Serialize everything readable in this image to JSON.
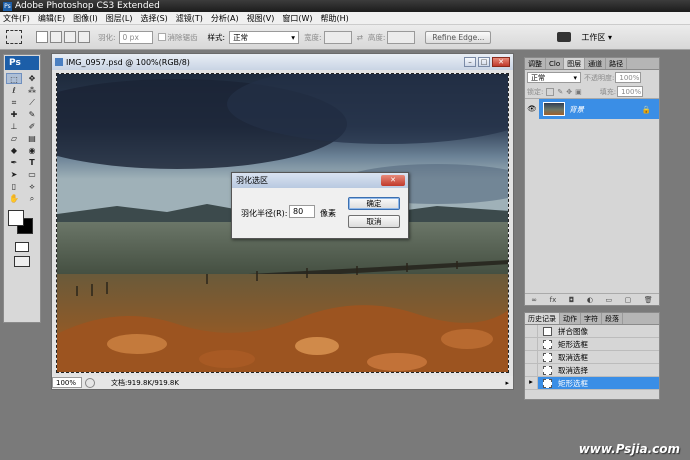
{
  "app": {
    "title": "Adobe Photoshop CS3 Extended",
    "icon_text": "Ps"
  },
  "menu": [
    "文件(F)",
    "编辑(E)",
    "图像(I)",
    "图层(L)",
    "选择(S)",
    "滤镜(T)",
    "分析(A)",
    "视图(V)",
    "窗口(W)",
    "帮助(H)"
  ],
  "options": {
    "feather_label": "羽化:",
    "feather_value": "0 px",
    "antialias_label": "消除锯齿",
    "style_label": "样式:",
    "style_value": "正常",
    "width_label": "宽度:",
    "height_label": "高度:",
    "refine_edge": "Refine Edge...",
    "workspace": "工作区 ▾"
  },
  "toolbox": {
    "logo": "Ps"
  },
  "document": {
    "title": "IMG_0957.psd @ 100%(RGB/8)",
    "zoom": "100%",
    "doc_info": "文档:919.8K/919.8K"
  },
  "dialog": {
    "title": "羽化选区",
    "label": "羽化半径(R):",
    "value": "80",
    "unit": "像素",
    "ok": "确定",
    "cancel": "取消"
  },
  "layers_panel": {
    "tabs": [
      "调整",
      "Clo",
      "图层",
      "通道",
      "路径"
    ],
    "blend_mode": "正常",
    "opacity_label": "不透明度:",
    "opacity_value": "100%",
    "lock_label": "锁定:",
    "fill_label": "填充:",
    "fill_value": "100%",
    "layer_name": "背景"
  },
  "history_panel": {
    "tabs": [
      "历史记录",
      "动作",
      "字符",
      "段落"
    ],
    "items": [
      "拼合图像",
      "矩形选框",
      "取消选框",
      "取消选择",
      "矩形选框"
    ]
  },
  "watermark": "www.Psjia.com"
}
